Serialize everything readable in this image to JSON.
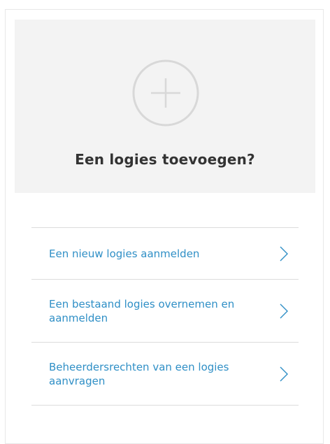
{
  "hero": {
    "icon": "plus-circle-icon",
    "title": "Een logies toevoegen?"
  },
  "links": [
    {
      "label": "Een nieuw logies aanmelden",
      "icon": "chevron-right-icon"
    },
    {
      "label": "Een bestaand logies overnemen en aanmelden",
      "icon": "chevron-right-icon"
    },
    {
      "label": "Beheerdersrechten van een logies aanvragen",
      "icon": "chevron-right-icon"
    }
  ],
  "colors": {
    "link": "#2f8fc6",
    "hero_bg": "#f3f3f3",
    "title": "#333333"
  }
}
